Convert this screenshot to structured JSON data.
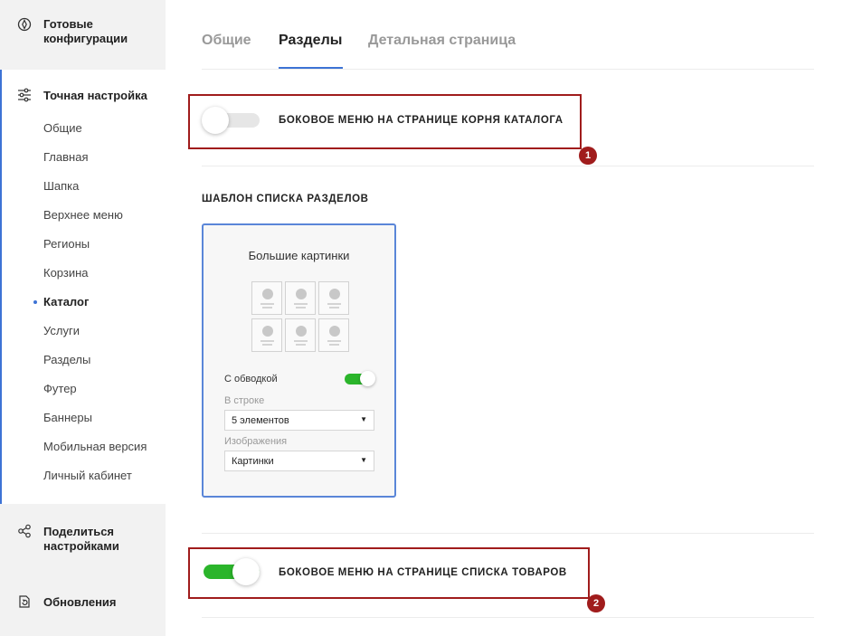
{
  "sidebar": {
    "configs": {
      "title": "Готовые конфигурации",
      "icon": "ready-configs-icon"
    },
    "tuning": {
      "title": "Точная настройка",
      "icon": "sliders-icon",
      "items": [
        {
          "label": "Общие"
        },
        {
          "label": "Главная"
        },
        {
          "label": "Шапка"
        },
        {
          "label": "Верхнее меню"
        },
        {
          "label": "Регионы"
        },
        {
          "label": "Корзина"
        },
        {
          "label": "Каталог",
          "active": true
        },
        {
          "label": "Услуги"
        },
        {
          "label": "Разделы"
        },
        {
          "label": "Футер"
        },
        {
          "label": "Баннеры"
        },
        {
          "label": "Мобильная версия"
        },
        {
          "label": "Личный кабинет"
        }
      ]
    },
    "share": {
      "title": "Поделиться настройками",
      "icon": "share-icon"
    },
    "updates": {
      "title": "Обновления",
      "icon": "updates-icon"
    }
  },
  "tabs": [
    {
      "label": "Общие",
      "active": false
    },
    {
      "label": "Разделы",
      "active": true
    },
    {
      "label": "Детальная страница",
      "active": false
    }
  ],
  "options": {
    "root_menu": {
      "label": "БОКОВОЕ МЕНЮ НА СТРАНИЦЕ КОРНЯ КАТАЛОГА",
      "enabled": false,
      "badge": "1"
    },
    "list_menu": {
      "label": "БОКОВОЕ МЕНЮ НА СТРАНИЦЕ СПИСКА ТОВАРОВ",
      "enabled": true,
      "badge": "2"
    }
  },
  "template": {
    "section_title": "ШАБЛОН СПИСКА РАЗДЕЛОВ",
    "card_title": "Большие картинки",
    "border_label": "С обводкой",
    "border_enabled": true,
    "row_label": "В строке",
    "row_value": "5 элементов",
    "images_label": "Изображения",
    "images_value": "Картинки"
  },
  "colors": {
    "accent": "#3d73d5",
    "highlight": "#a01c1c",
    "toggle_on": "#2bb52b",
    "sidebar_bg": "#f2f2f2"
  }
}
